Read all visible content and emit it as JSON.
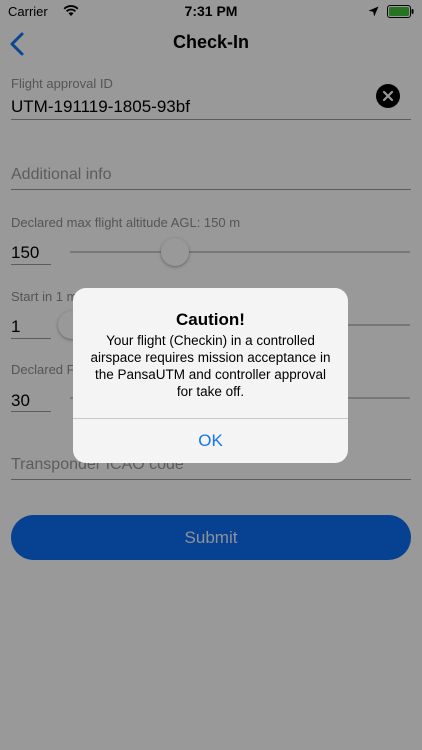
{
  "status_bar": {
    "carrier": "Carrier",
    "time": "7:31 PM"
  },
  "nav": {
    "title": "Check-In"
  },
  "form": {
    "flight_approval": {
      "label": "Flight approval ID",
      "value": "UTM-191119-1805-93bf"
    },
    "additional_info": {
      "placeholder": "Additional info"
    },
    "altitude": {
      "label": "Declared max flight altitude AGL: 150 m",
      "value": "150",
      "slider_fraction": 0.31
    },
    "start": {
      "label": "Start in 1 m",
      "value": "1",
      "slider_fraction": 0.0
    },
    "duration": {
      "label": "Declared Fl",
      "value": "30"
    },
    "transponder": {
      "placeholder": "Transponder ICAO code"
    },
    "submit_label": "Submit"
  },
  "alert": {
    "title": "Caution!",
    "message": "Your flight (Checkin) in a controlled airspace requires mission acceptance in the PansaUTM and controller approval for take off.",
    "ok_label": "OK"
  },
  "colors": {
    "accent": "#0a6ff2",
    "alert_button": "#1575f0"
  }
}
